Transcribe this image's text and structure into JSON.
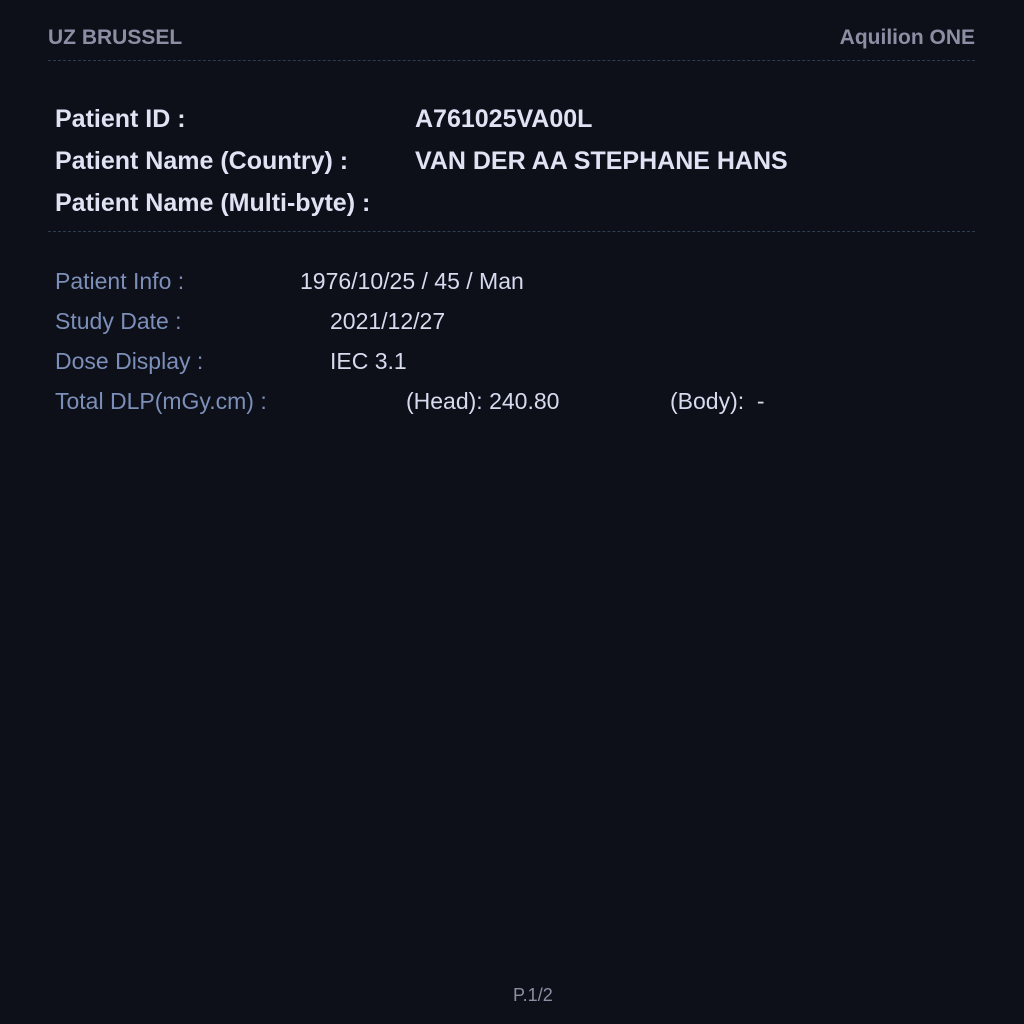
{
  "header": {
    "institution": "UZ BRUSSEL",
    "scanner": "Aquilion ONE"
  },
  "patient": {
    "id_label": "Patient ID :",
    "id_value": "A761025VA00L",
    "name_country_label": "Patient Name (Country) :",
    "name_country_value": "VAN DER AA STEPHANE HANS",
    "name_multibyte_label": "Patient Name (Multi-byte) :",
    "name_multibyte_value": ""
  },
  "info": {
    "patient_info_label": "Patient Info :",
    "patient_info_value": "1976/10/25 / 45 / Man",
    "study_date_label": "Study Date :",
    "study_date_value": "2021/12/27",
    "dose_display_label": "Dose Display :",
    "dose_display_value": "IEC 3.1",
    "total_dlp_label": "Total DLP(mGy.cm) :",
    "dlp_head": "(Head): 240.80",
    "dlp_body": "(Body):  -"
  },
  "footer": {
    "page": "P.1/2"
  }
}
